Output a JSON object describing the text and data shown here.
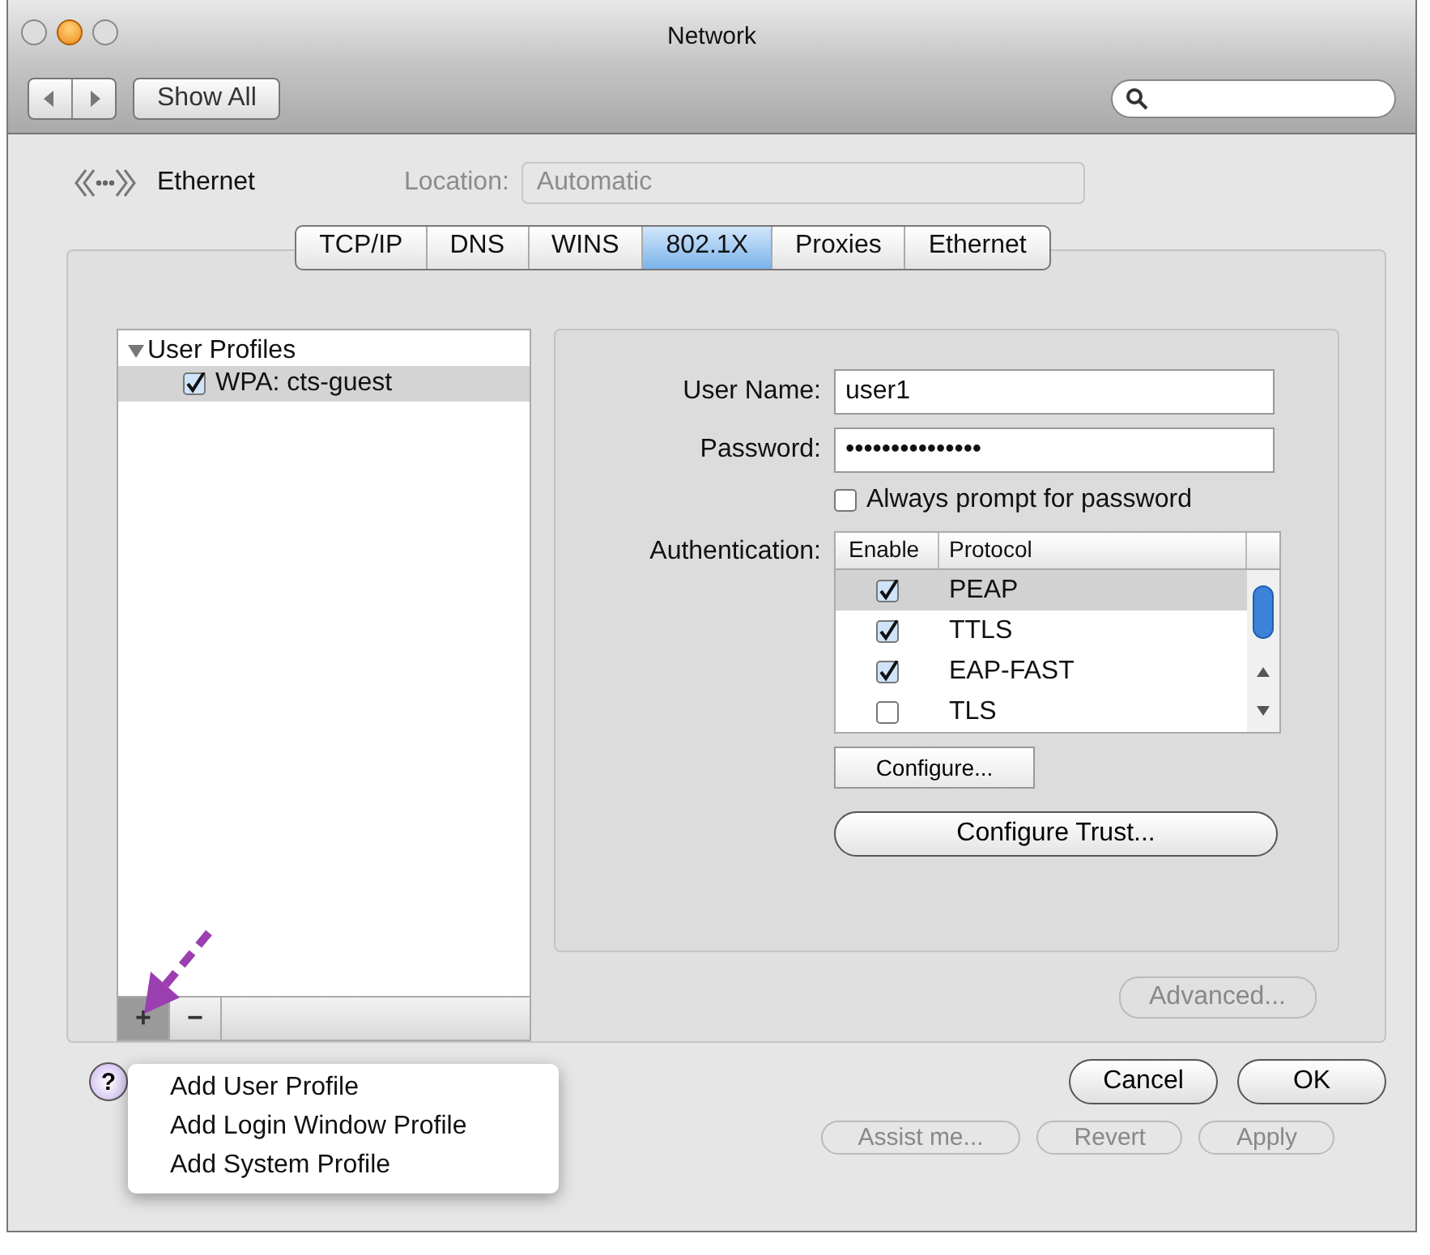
{
  "window": {
    "title": "Network"
  },
  "toolbar": {
    "show_all": "Show All"
  },
  "service": {
    "name": "Ethernet"
  },
  "location": {
    "label": "Location:",
    "value": "Automatic"
  },
  "tabs": [
    {
      "label": "TCP/IP",
      "selected": false
    },
    {
      "label": "DNS",
      "selected": false
    },
    {
      "label": "WINS",
      "selected": false
    },
    {
      "label": "802.1X",
      "selected": true
    },
    {
      "label": "Proxies",
      "selected": false
    },
    {
      "label": "Ethernet",
      "selected": false
    }
  ],
  "profiles": [
    {
      "label": "User Profiles",
      "expanded": true,
      "children": [
        {
          "label": "WPA: cts-guest",
          "checked": true,
          "selected": true
        }
      ]
    }
  ],
  "list_buttons": [
    "+",
    "−"
  ],
  "add_menu": {
    "items": [
      "Add User Profile",
      "Add Login Window Profile",
      "Add System Profile"
    ]
  },
  "form": {
    "user_name": {
      "label": "User Name:",
      "value": "user1"
    },
    "password": {
      "label": "Password:",
      "value": "•••••••••••••••"
    },
    "always_prompt": {
      "label": "Always prompt for password",
      "checked": false
    },
    "authentication": {
      "label": "Authentication:",
      "columns": [
        "Enable",
        "Protocol"
      ],
      "rows": [
        {
          "protocol": "PEAP",
          "enabled": true,
          "selected": true
        },
        {
          "protocol": "TTLS",
          "enabled": true,
          "selected": false
        },
        {
          "protocol": "EAP-FAST",
          "enabled": true,
          "selected": false
        },
        {
          "protocol": "TLS",
          "enabled": false,
          "selected": false
        }
      ]
    },
    "configure": "Configure...",
    "configure_trust": "Configure Trust..."
  },
  "advanced": "Advanced...",
  "help": "?",
  "dialog_buttons": [
    "Cancel",
    "OK"
  ],
  "footer_buttons": [
    "Assist me...",
    "Revert",
    "Apply"
  ]
}
